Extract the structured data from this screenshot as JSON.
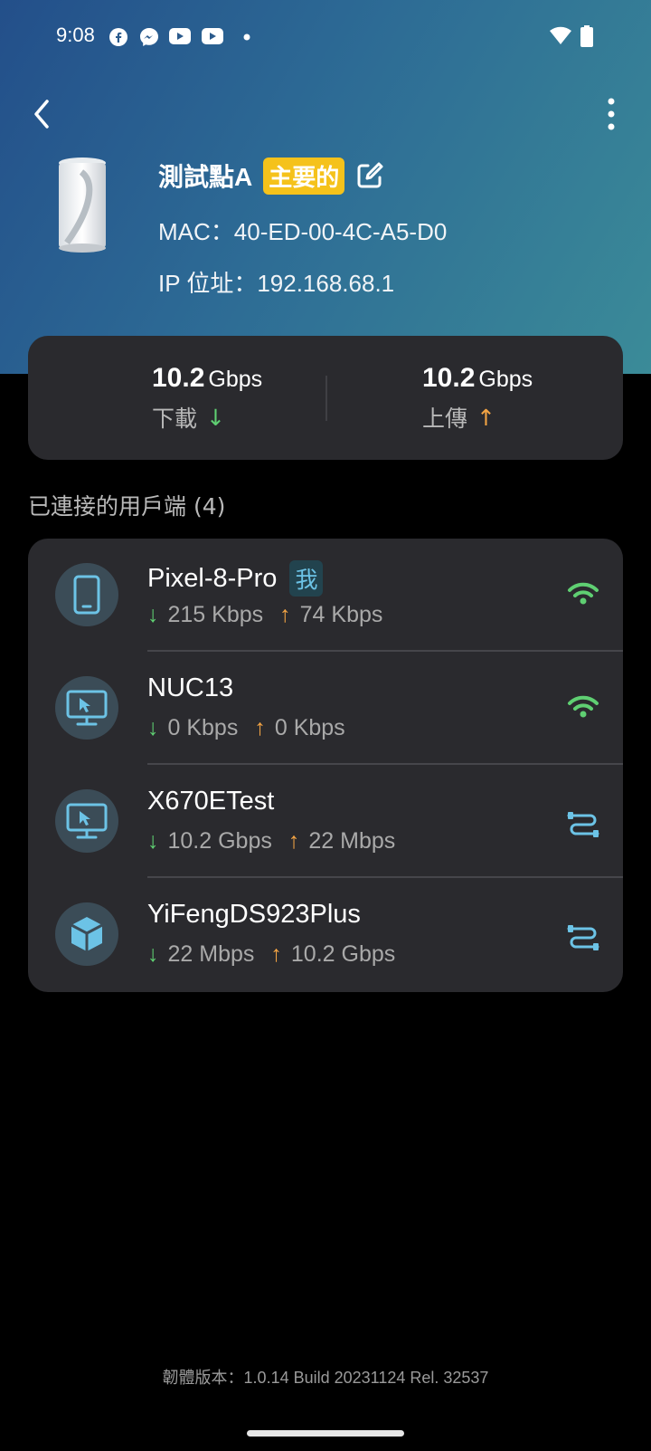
{
  "status_bar": {
    "time": "9:08",
    "icons": [
      "facebook-icon",
      "messenger-icon",
      "youtube-icon",
      "youtube-icon",
      "dot-icon",
      "wifi-icon",
      "battery-icon"
    ]
  },
  "device": {
    "name": "測試點A",
    "badge": "主要的",
    "mac": "MAC：40-ED-00-4C-A5-D0",
    "ip": "IP 位址：192.168.68.1"
  },
  "speeds": {
    "download": {
      "value": "10.2",
      "unit": "Gbps",
      "label": "下載",
      "arrow": "↓"
    },
    "upload": {
      "value": "10.2",
      "unit": "Gbps",
      "label": "上傳",
      "arrow": "↑"
    }
  },
  "clients_title": "已連接的用戶端 (4)",
  "clients": [
    {
      "name": "Pixel-8-Pro",
      "badge": "我",
      "down": "215 Kbps",
      "up": "74 Kbps",
      "icon": "phone-icon",
      "connection": "wifi-icon"
    },
    {
      "name": "NUC13",
      "badge": "",
      "down": "0 Kbps",
      "up": "0 Kbps",
      "icon": "monitor-icon",
      "connection": "wifi-icon"
    },
    {
      "name": "X670ETest",
      "badge": "",
      "down": "10.2 Gbps",
      "up": "22 Mbps",
      "icon": "monitor-icon",
      "connection": "ethernet-icon"
    },
    {
      "name": "YiFengDS923Plus",
      "badge": "",
      "down": "22 Mbps",
      "up": "10.2 Gbps",
      "icon": "nas-cube-icon",
      "connection": "ethernet-icon"
    }
  ],
  "arrows": {
    "down": "↓",
    "up": "↑"
  },
  "footer": "韌體版本：1.0.14 Build 20231124 Rel. 32537",
  "colors": {
    "badge_yellow": "#f5c21b",
    "wifi_green": "#5fcf72",
    "ethernet_blue": "#6cc3e6",
    "download_green": "#5fcf72",
    "upload_orange": "#f3a444"
  }
}
